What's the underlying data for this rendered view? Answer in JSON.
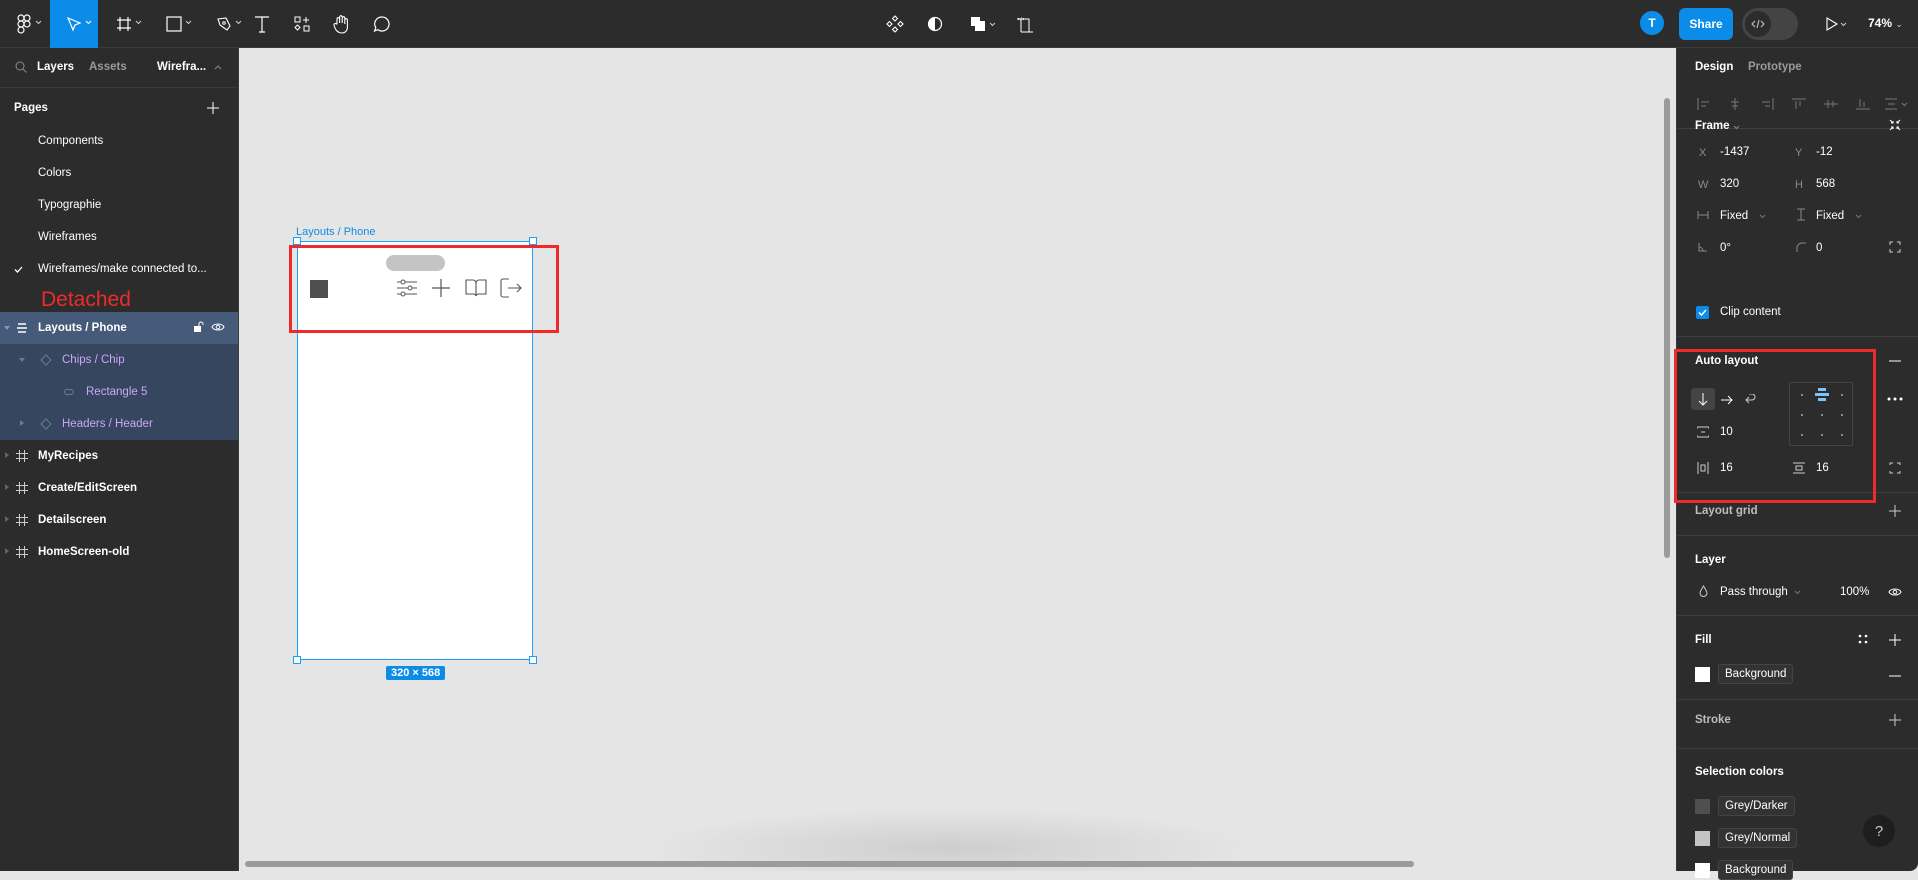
{
  "toolbar": {
    "tools": [
      {
        "name": "main-menu",
        "icon": "figma-logo-icon"
      },
      {
        "name": "move-tool",
        "icon": "cursor-icon",
        "active": true
      },
      {
        "name": "frame-tool",
        "icon": "frame-icon"
      },
      {
        "name": "shape-tool",
        "icon": "rectangle-icon"
      },
      {
        "name": "pen-tool",
        "icon": "pen-icon"
      },
      {
        "name": "text-tool",
        "icon": "text-icon"
      },
      {
        "name": "resources-tool",
        "icon": "resources-icon"
      },
      {
        "name": "hand-tool",
        "icon": "hand-icon"
      },
      {
        "name": "comment-tool",
        "icon": "comment-icon"
      }
    ],
    "center_tools": [
      "component-icon",
      "contrast-icon",
      "boolean-icon",
      "crop-icon"
    ],
    "avatar_initial": "T",
    "share_label": "Share",
    "zoom_level": "74%",
    "accent": "#0c8ce9"
  },
  "left_panel": {
    "tabs": {
      "layers": "Layers",
      "assets": "Assets",
      "page_selector": "Wirefra..."
    },
    "pages_title": "Pages",
    "pages": [
      {
        "label": "Components",
        "current": false
      },
      {
        "label": "Colors",
        "current": false
      },
      {
        "label": "Typographie",
        "current": false
      },
      {
        "label": "Wireframes",
        "current": false
      },
      {
        "label": "Wireframes/make connected to...",
        "current": true
      }
    ],
    "annotation": "Detached",
    "layers": [
      {
        "label": "Layouts / Phone",
        "type": "auto-layout-frame",
        "selected": true,
        "expanded": true,
        "depth": 0
      },
      {
        "label": "Chips / Chip",
        "type": "instance",
        "expanded": true,
        "depth": 1
      },
      {
        "label": "Rectangle 5",
        "type": "rectangle",
        "depth": 2
      },
      {
        "label": "Headers / Header",
        "type": "instance",
        "expanded": false,
        "depth": 1
      },
      {
        "label": "MyRecipes",
        "type": "frame",
        "depth": 0
      },
      {
        "label": "Create/EditScreen",
        "type": "frame",
        "depth": 0
      },
      {
        "label": "Detailscreen",
        "type": "frame",
        "depth": 0
      },
      {
        "label": "HomeScreen-old",
        "type": "frame",
        "depth": 0
      }
    ]
  },
  "canvas": {
    "frame_label": "Layouts / Phone",
    "size_badge": "320 × 568",
    "header_icons": [
      "sliders-icon",
      "plus-icon",
      "book-icon",
      "logout-icon"
    ]
  },
  "right_panel": {
    "tabs": {
      "design": "Design",
      "prototype": "Prototype"
    },
    "frame": {
      "title": "Frame",
      "x_label": "X",
      "x": "-1437",
      "y_label": "Y",
      "y": "-12",
      "w_label": "W",
      "w": "320",
      "h_label": "H",
      "h": "568",
      "h_sizing": "Fixed",
      "v_sizing": "Fixed",
      "rotation": "0°",
      "radius": "0",
      "clip_content_label": "Clip content",
      "clip_content": true
    },
    "auto_layout": {
      "title": "Auto layout",
      "direction": "vertical",
      "gap": "10",
      "h_padding": "16",
      "v_padding": "16",
      "alignment": "top-center"
    },
    "layout_grid": {
      "title": "Layout grid"
    },
    "layer": {
      "title": "Layer",
      "blend": "Pass through",
      "opacity": "100%"
    },
    "fill": {
      "title": "Fill",
      "style": "Background",
      "color": "#ffffff"
    },
    "stroke": {
      "title": "Stroke"
    },
    "selection_colors": {
      "title": "Selection colors",
      "items": [
        {
          "label": "Grey/Darker",
          "color": "#4f4f4f"
        },
        {
          "label": "Grey/Normal",
          "color": "#c4c4c4"
        },
        {
          "label": "Background",
          "color": "#ffffff"
        }
      ]
    },
    "help": "?"
  }
}
